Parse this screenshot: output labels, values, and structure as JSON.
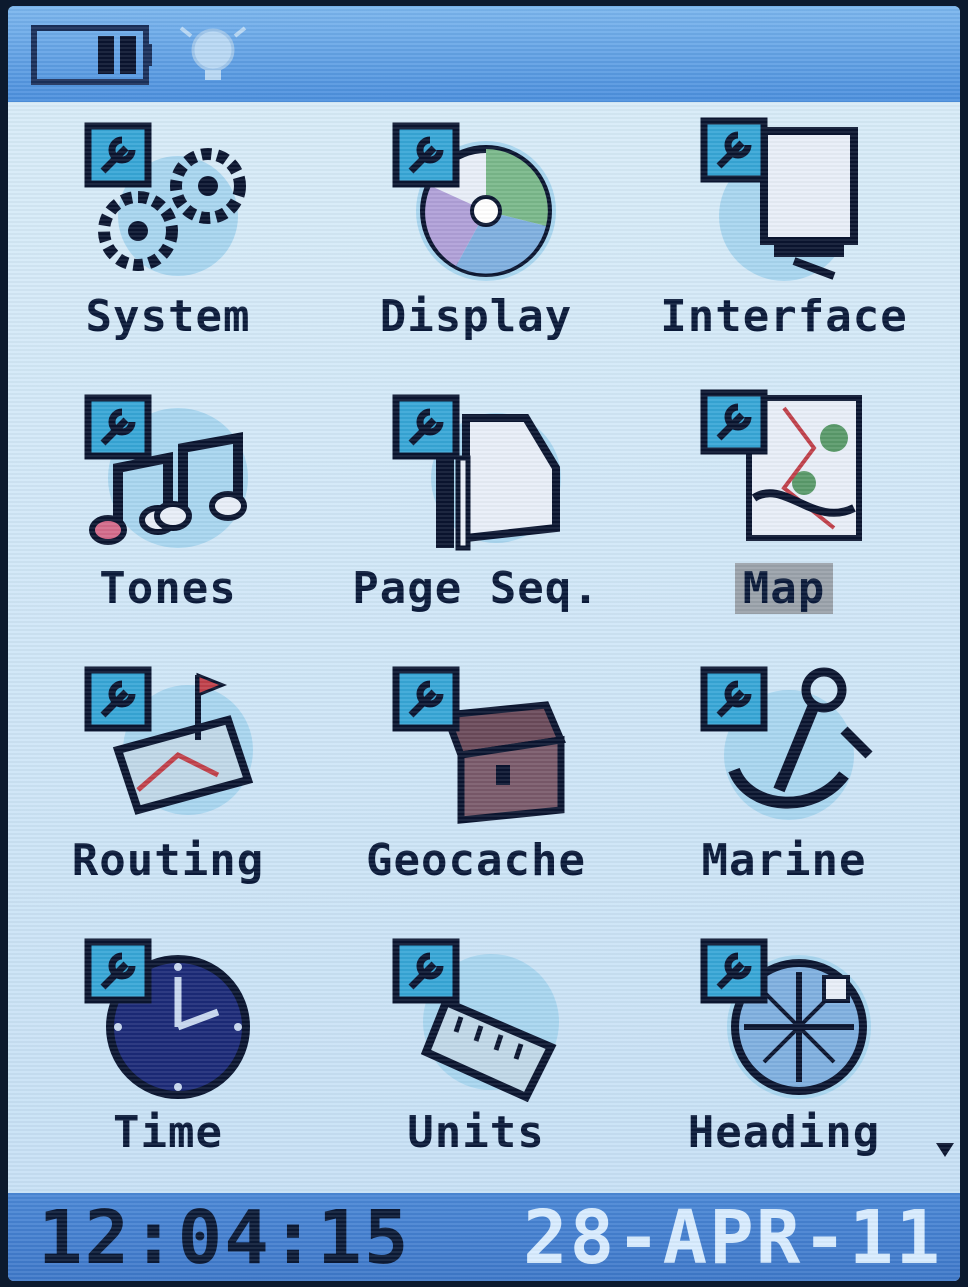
{
  "status_bar": {
    "battery_icon": "battery-icon",
    "backlight_icon": "lightbulb-icon"
  },
  "menu": {
    "items": [
      {
        "label": "System",
        "icon": "gears-icon"
      },
      {
        "label": "Display",
        "icon": "disc-display-icon"
      },
      {
        "label": "Interface",
        "icon": "computer-interface-icon"
      },
      {
        "label": "Tones",
        "icon": "music-notes-icon"
      },
      {
        "label": "Page Seq.",
        "icon": "page-sequence-icon"
      },
      {
        "label": "Map",
        "icon": "map-icon"
      },
      {
        "label": "Routing",
        "icon": "routing-map-icon"
      },
      {
        "label": "Geocache",
        "icon": "treasure-chest-icon"
      },
      {
        "label": "Marine",
        "icon": "anchor-icon"
      },
      {
        "label": "Time",
        "icon": "clock-icon"
      },
      {
        "label": "Units",
        "icon": "ruler-icon"
      },
      {
        "label": "Heading",
        "icon": "compass-icon"
      }
    ],
    "selected": "Map"
  },
  "footer": {
    "time": "12:04:15",
    "date": "28-APR-11"
  },
  "colors": {
    "screen_bg": "#cfe6f7",
    "status_bar": "#4b8fdd",
    "footer": "#3e78c9",
    "accent": "#37a6d7",
    "text": "#0a1a3a",
    "selection": "#9aa2aa"
  }
}
